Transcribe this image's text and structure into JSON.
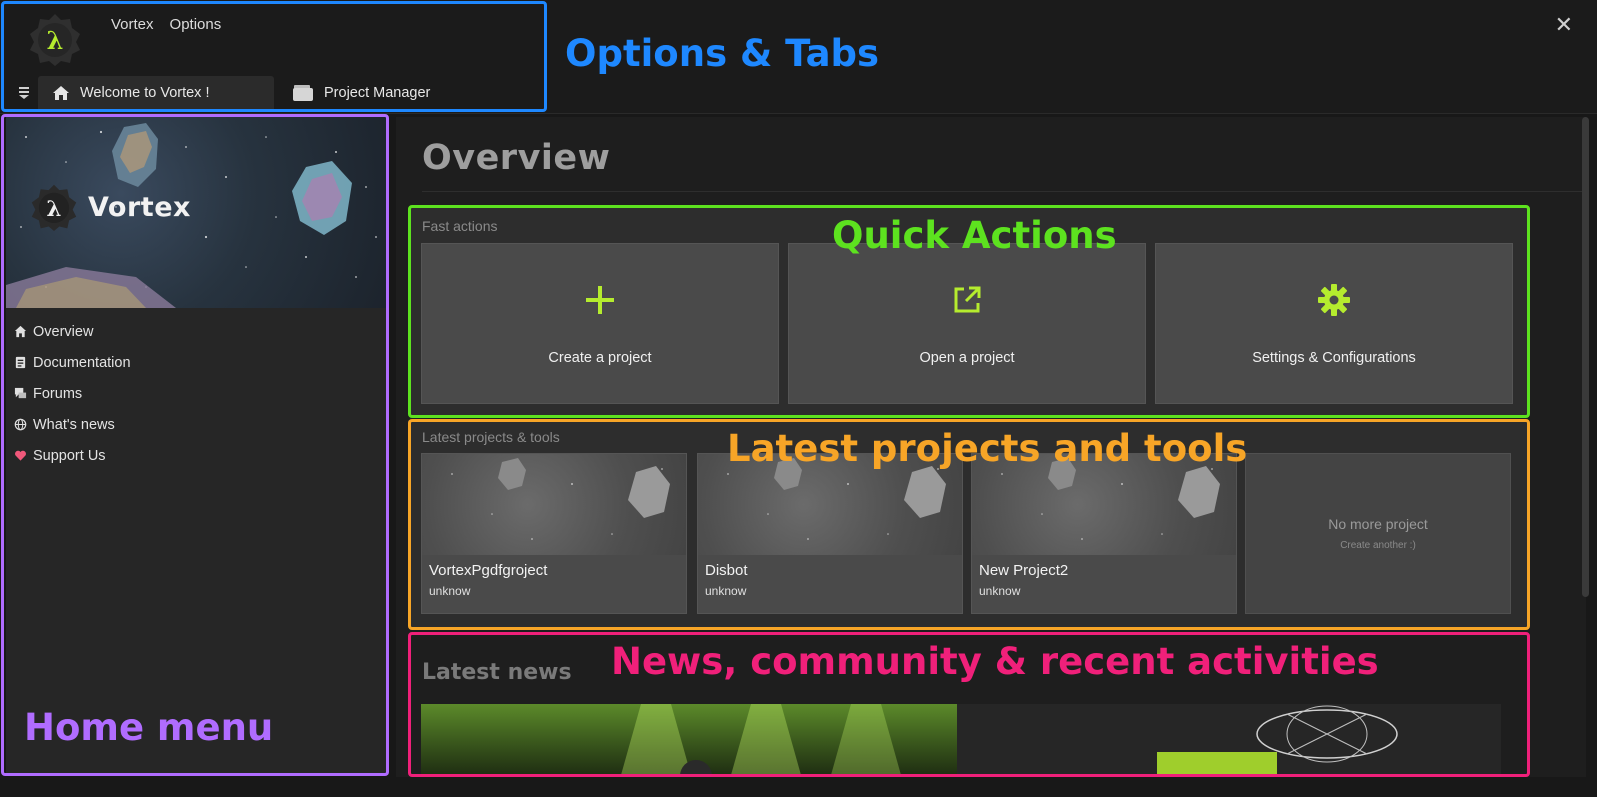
{
  "menu": {
    "vortex": "Vortex",
    "options": "Options"
  },
  "window": {
    "close_glyph": "✕"
  },
  "tabs": [
    {
      "label": "Welcome to Vortex !",
      "icon": "home-icon",
      "active": true
    },
    {
      "label": "Project Manager",
      "icon": "folder-icon",
      "active": false
    }
  ],
  "sidebar": {
    "brand": "Vortex",
    "items": [
      {
        "label": "Overview",
        "icon": "home-icon"
      },
      {
        "label": "Documentation",
        "icon": "document-icon"
      },
      {
        "label": "Forums",
        "icon": "chat-icon"
      },
      {
        "label": "What's news",
        "icon": "globe-icon"
      },
      {
        "label": "Support Us",
        "icon": "heart-icon"
      }
    ]
  },
  "main": {
    "title": "Overview",
    "fast_actions": {
      "label": "Fast actions",
      "items": [
        {
          "label": "Create a project",
          "icon": "plus-icon"
        },
        {
          "label": "Open a project",
          "icon": "external-link-icon"
        },
        {
          "label": "Settings & Configurations",
          "icon": "gear-icon"
        }
      ]
    },
    "latest": {
      "label": "Latest projects & tools",
      "projects": [
        {
          "name": "VortexPgdfgroject",
          "sub": "unknow"
        },
        {
          "name": "Disbot",
          "sub": "unknow"
        },
        {
          "name": "New Project2",
          "sub": "unknow"
        }
      ],
      "empty_title": "No more project",
      "empty_sub": "Create another :)"
    },
    "news": {
      "title": "Latest news"
    }
  },
  "annotations": {
    "options_tabs": "Options & Tabs",
    "quick_actions": "Quick Actions",
    "latest_projects": "Latest projects and tools",
    "news_community": "News, community & recent activities",
    "home_menu": "Home menu"
  },
  "colors": {
    "accent": "#b5ec2e",
    "anno_blue": "#1e88ff",
    "anno_green": "#5de21f",
    "anno_orange": "#f7a527",
    "anno_pink": "#f0207a",
    "anno_purple": "#b06cff"
  }
}
